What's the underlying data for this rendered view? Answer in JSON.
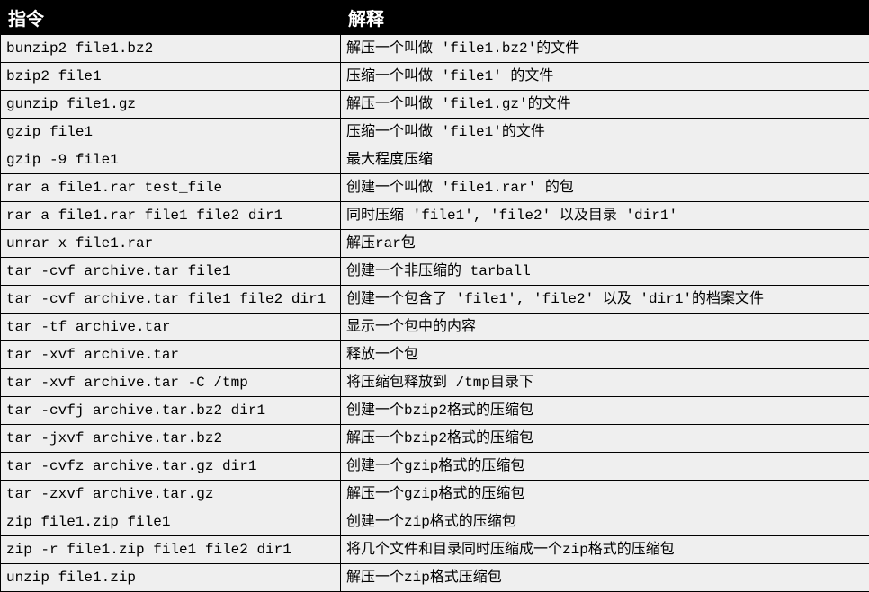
{
  "headers": {
    "command": "指令",
    "description": "解释"
  },
  "rows": [
    {
      "cmd": "bunzip2 file1.bz2",
      "desc": "解压一个叫做 'file1.bz2'的文件"
    },
    {
      "cmd": "bzip2 file1",
      "desc": "压缩一个叫做 'file1' 的文件"
    },
    {
      "cmd": "gunzip file1.gz",
      "desc": "解压一个叫做 'file1.gz'的文件"
    },
    {
      "cmd": "gzip file1",
      "desc": "压缩一个叫做 'file1'的文件"
    },
    {
      "cmd": "gzip -9 file1",
      "desc": "最大程度压缩"
    },
    {
      "cmd": "rar a file1.rar test_file",
      "desc": "创建一个叫做 'file1.rar' 的包"
    },
    {
      "cmd": "rar a file1.rar file1 file2 dir1",
      "desc": "同时压缩 'file1', 'file2' 以及目录 'dir1'"
    },
    {
      "cmd": "unrar x file1.rar",
      "desc": "解压rar包"
    },
    {
      "cmd": "tar -cvf archive.tar file1",
      "desc": "创建一个非压缩的 tarball"
    },
    {
      "cmd": "tar -cvf archive.tar file1 file2 dir1",
      "desc": "创建一个包含了 'file1', 'file2' 以及 'dir1'的档案文件"
    },
    {
      "cmd": "tar -tf archive.tar",
      "desc": "显示一个包中的内容"
    },
    {
      "cmd": "tar -xvf archive.tar",
      "desc": "释放一个包"
    },
    {
      "cmd": "tar -xvf archive.tar -C /tmp",
      "desc": "将压缩包释放到 /tmp目录下"
    },
    {
      "cmd": "tar -cvfj archive.tar.bz2 dir1",
      "desc": "创建一个bzip2格式的压缩包"
    },
    {
      "cmd": "tar -jxvf archive.tar.bz2",
      "desc": "解压一个bzip2格式的压缩包"
    },
    {
      "cmd": "tar -cvfz archive.tar.gz dir1",
      "desc": "创建一个gzip格式的压缩包"
    },
    {
      "cmd": "tar -zxvf archive.tar.gz",
      "desc": "解压一个gzip格式的压缩包"
    },
    {
      "cmd": "zip file1.zip file1",
      "desc": "创建一个zip格式的压缩包"
    },
    {
      "cmd": "zip -r file1.zip file1 file2 dir1",
      "desc": "将几个文件和目录同时压缩成一个zip格式的压缩包"
    },
    {
      "cmd": "unzip file1.zip",
      "desc": "解压一个zip格式压缩包"
    }
  ]
}
